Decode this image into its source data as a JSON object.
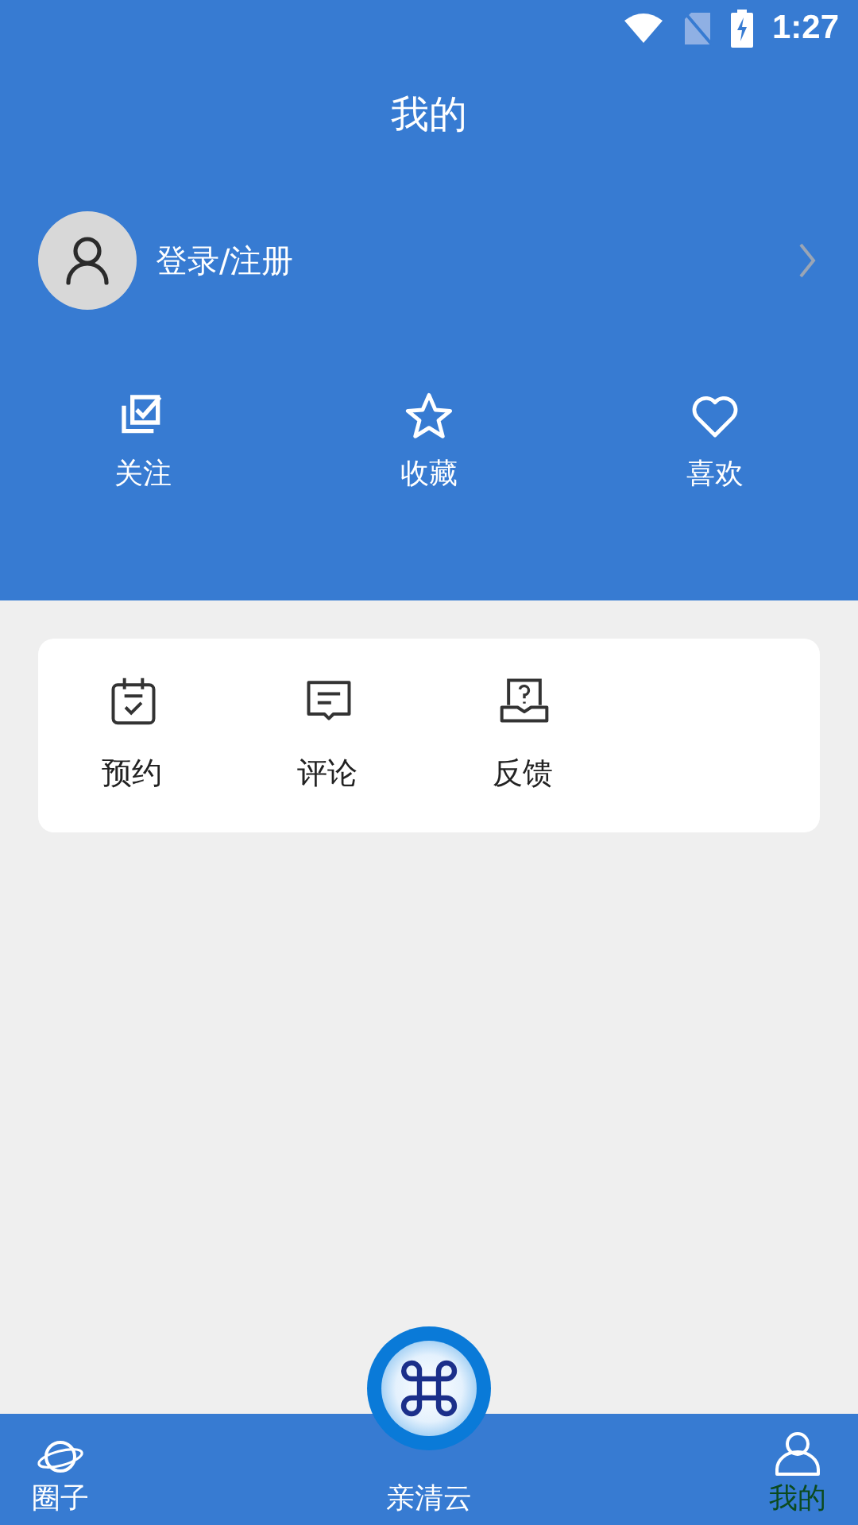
{
  "status_bar": {
    "time": "1:27"
  },
  "header": {
    "title": "我的"
  },
  "profile": {
    "login_label": "登录/注册"
  },
  "quick_actions": [
    {
      "kind": "follow",
      "label": "关注"
    },
    {
      "kind": "favorite",
      "label": "收藏"
    },
    {
      "kind": "like",
      "label": "喜欢"
    }
  ],
  "services": [
    {
      "kind": "booking",
      "label": "预约"
    },
    {
      "kind": "comment",
      "label": "评论"
    },
    {
      "kind": "feedback",
      "label": "反馈"
    }
  ],
  "bottom_nav": [
    {
      "kind": "circle",
      "label": "圈子",
      "selected": false
    },
    {
      "kind": "center",
      "label": "亲清云",
      "selected": false
    },
    {
      "kind": "mine",
      "label": "我的",
      "selected": true
    }
  ]
}
